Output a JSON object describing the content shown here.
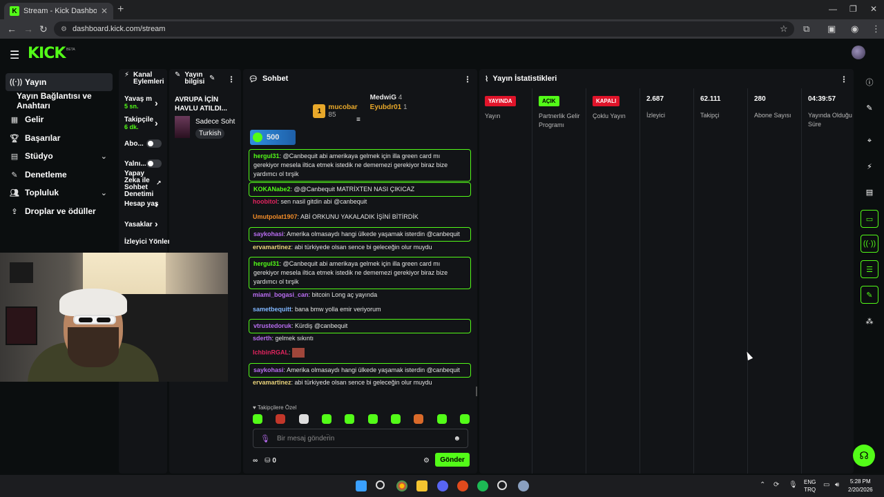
{
  "browser": {
    "tab_title": "Stream - Kick Dashboard",
    "url": "dashboard.kick.com/stream"
  },
  "header": {
    "logo": "KICK",
    "beta": "BETA"
  },
  "sidebar": {
    "items": [
      {
        "label": "Yayın",
        "icon": "broadcast-icon"
      },
      {
        "label": "Yayın Bağlantısı ve Anahtarı",
        "icon": ""
      },
      {
        "label": "Gelir",
        "icon": "revenue-icon"
      },
      {
        "label": "Başarılar",
        "icon": "trophy-icon"
      },
      {
        "label": "Stüdyo",
        "icon": "studio-icon"
      },
      {
        "label": "Denetleme",
        "icon": "wrench-icon"
      },
      {
        "label": "Topluluk",
        "icon": "community-icon"
      },
      {
        "label": "Droplar ve ödüller",
        "icon": "drops-icon"
      }
    ]
  },
  "channel_actions": {
    "title": "Kanal Eylemleri",
    "slow_mode": {
      "label": "Yavaş m",
      "sub": "5 sn."
    },
    "followers": {
      "label": "Takipçile",
      "sub": "6 dk."
    },
    "subscribers": "Abo...",
    "emotes": "Yalnı...",
    "ai_mod": "Yapay Zeka ile Sohbet Denetimi",
    "account_age": "Hesap yaş",
    "bans": "Yasaklar",
    "viewer_mods": "İzleyici Yönler"
  },
  "stream_info": {
    "title": "Yayın bilgisi",
    "stream_title": "AVRUPA İÇİN HAVLU ATILDI...",
    "category": "Sadece Soht",
    "tag": "Turkish"
  },
  "chat": {
    "title": "Sohbet",
    "leaderboard": {
      "first": {
        "rank": "1",
        "name": "mucobar",
        "value": "85"
      },
      "second": {
        "name": "MedwiG",
        "value": "4"
      },
      "third": {
        "name": "Eyubdr01",
        "value": "1"
      }
    },
    "pinned_value": "500",
    "messages": [
      {
        "user": "hergul31",
        "color": "#53fc18",
        "text": "@Canbequit abi amerikaya gelmek için illa green card mı gerekiyor mesela iltica etmek istedik ne dememezi gerekiyor biraz bize yardımcı ol tırşik",
        "boxed": true
      },
      {
        "user": "KOKANabe2",
        "color": "#53fc18",
        "text": "@@Canbequit MATRİXTEN NASI ÇIKICAZ",
        "boxed": true
      },
      {
        "user": "hoobitol",
        "color": "#e0245e",
        "text": "sen nasil gitdin abi @canbequit",
        "boxed": false
      },
      {
        "user": "Umutpolat1907",
        "color": "#f28c28",
        "text": "ABİ ORKUNU YAKALADIK İŞİNİ BİTİRDİK",
        "boxed": false
      },
      {
        "user": "saykohasi",
        "color": "#b86cf0",
        "text": "Amerika olmasaydı hangi ülkede yaşamak isterdin @canbequit",
        "boxed": true
      },
      {
        "user": "ervamartinez",
        "color": "#e8d27a",
        "text": "abi türkiyede olsan sence bi geleceğin olur muydu",
        "boxed": false
      },
      {
        "user": "hergul31",
        "color": "#53fc18",
        "text": "@Canbequit abi amerikaya gelmek için illa green card mı gerekiyor mesela iltica etmek istedik ne dememezi gerekiyor biraz bize yardımcı ol tırşik",
        "boxed": true
      },
      {
        "user": "miami_bogasi_can",
        "color": "#b86cf0",
        "text": "bitcoin Long aç yayında",
        "boxed": false
      },
      {
        "user": "sametbequitt",
        "color": "#7fb6ff",
        "text": "bana bmw yolla emir veriyorum",
        "boxed": false
      },
      {
        "user": "vtrustedoruk",
        "color": "#b86cf0",
        "text": "Kürdiş @canbequit",
        "boxed": true
      },
      {
        "user": "sderth",
        "color": "#b86cf0",
        "text": "gelmek sıkıntı",
        "boxed": false
      },
      {
        "user": "IchbinRGAL",
        "color": "#e0245e",
        "text": "",
        "boxed": false
      },
      {
        "user": "saykohasi",
        "color": "#b86cf0",
        "text": "Amerika olmasaydı hangi ülkede yaşamak isterdin @canbequit",
        "boxed": true
      },
      {
        "user": "ervamartinez",
        "color": "#e8d27a",
        "text": "abi türkiyede olsan sence bi geleceğin olur muydu",
        "boxed": false
      }
    ],
    "follower_only": "Takipçilere Özel",
    "input_placeholder": "Bir mesaj gönder̈in",
    "points": "0",
    "send": "Gönder"
  },
  "stats": {
    "title": "Yayın İstatistikleri",
    "cols": [
      {
        "badge": "YAYINDA",
        "badge_color": "#e0142a",
        "label": "Yayın"
      },
      {
        "badge": "AÇIK",
        "badge_color": "#53fc18",
        "label": "Partnerlik Gelir Programı"
      },
      {
        "badge": "KAPALI",
        "badge_color": "#e0142a",
        "label": "Çoklu Yayın"
      },
      {
        "value": "2.687",
        "label": "İzleyici"
      },
      {
        "value": "62.111",
        "label": "Takipçi"
      },
      {
        "value": "280",
        "label": "Abone Sayısı"
      },
      {
        "value": "04:39:57",
        "label": "Yayında Olduğu Süre"
      }
    ]
  },
  "taskbar": {
    "lang": "ENG",
    "region": "TRQ",
    "time": "5:28 PM",
    "date": "2/20/2026"
  }
}
